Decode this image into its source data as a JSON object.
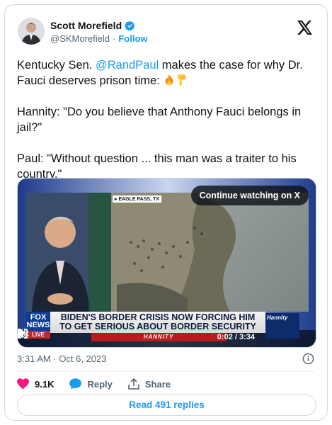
{
  "author": {
    "display_name": "Scott Morefield",
    "handle": "@SKMorefield",
    "separator": "·",
    "follow_label": "Follow"
  },
  "tweet": {
    "line1_before": "Kentucky Sen. ",
    "mention": "@RandPaul",
    "line1_after": " makes the case for why Dr. Fauci deserves prison time: ",
    "para2": "Hannity: \"Do you believe that Anthony Fauci belongs in jail?\"",
    "para3": "Paul: \"Without question ... this man was a traiter to his country.\""
  },
  "media": {
    "continue_label": "Continue watching on X",
    "location": "▸ EAGLE PASS, TX",
    "chyron_line1": "BIDEN'S BORDER CRISIS NOW FORCING HIM",
    "chyron_line2": "TO GET SERIOUS ABOUT BORDER SECURITY",
    "chyron_sub": "HANNITY",
    "channel_logo": "FOX NEWS",
    "channel_live": "LIVE",
    "show_logo": "Hannity",
    "time": "0:02 / 3:34"
  },
  "meta": {
    "timestamp": "3:31 AM · Oct 6, 2023"
  },
  "actions": {
    "likes": "9.1K",
    "reply_label": "Reply",
    "share_label": "Share"
  },
  "read_replies_label": "Read 491 replies",
  "colors": {
    "accent": "#1d9bf0",
    "like": "#f91880",
    "text": "#0f1419",
    "muted": "#536471"
  },
  "icons": [
    "verified-badge-icon",
    "x-logo-icon",
    "fire-emoji-icon",
    "pointing-down-emoji-icon",
    "play-icon",
    "volume-icon",
    "x-mark-icon",
    "fullscreen-icon",
    "info-icon",
    "heart-icon",
    "reply-bubble-icon",
    "share-icon"
  ]
}
